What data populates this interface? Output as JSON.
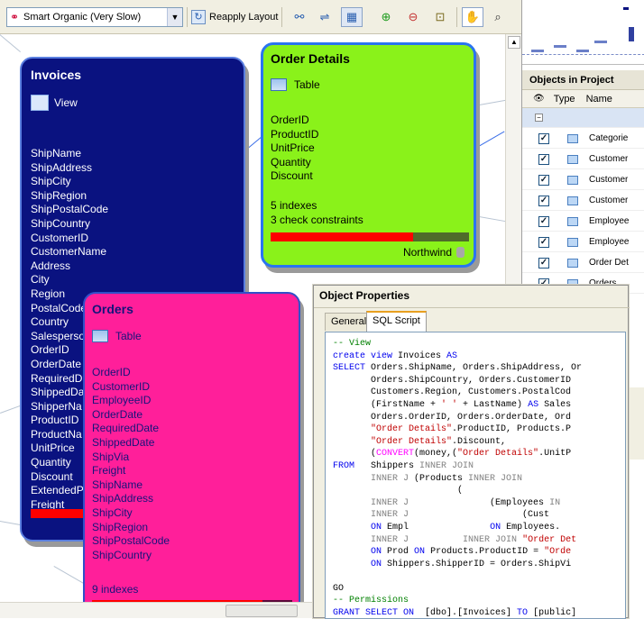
{
  "toolbar": {
    "layout_combo": "Smart Organic (Very Slow)",
    "reapply_label": "Reapply Layout"
  },
  "invoices": {
    "title": "Invoices",
    "type_label": "View",
    "fields": [
      "ShipName",
      "ShipAddress",
      "ShipCity",
      "ShipRegion",
      "ShipPostalCode",
      "ShipCountry",
      "CustomerID",
      "CustomerName",
      "Address",
      "City",
      "Region",
      "PostalCode",
      "Country",
      "Salesperson",
      "OrderID",
      "OrderDate",
      "RequiredD",
      "ShippedDa",
      "ShipperNa",
      "ProductID",
      "ProductNa",
      "UnitPrice",
      "Quantity",
      "Discount",
      "ExtendedP",
      "Freight"
    ]
  },
  "order_details": {
    "title": "Order Details",
    "type_label": "Table",
    "fields": [
      "OrderID",
      "ProductID",
      "UnitPrice",
      "Quantity",
      "Discount"
    ],
    "indexes": "5 indexes",
    "constraints": "3 check constraints",
    "database": "Northwind"
  },
  "orders": {
    "title": "Orders",
    "type_label": "Table",
    "fields": [
      "OrderID",
      "CustomerID",
      "EmployeeID",
      "OrderDate",
      "RequiredDate",
      "ShippedDate",
      "ShipVia",
      "Freight",
      "ShipName",
      "ShipAddress",
      "ShipCity",
      "ShipRegion",
      "ShipPostalCode",
      "ShipCountry"
    ],
    "indexes": "9 indexes"
  },
  "objects_panel": {
    "title": "Objects in Project",
    "col_type": "Type",
    "col_name": "Name",
    "rows": [
      "Categorie",
      "Customer",
      "Customer",
      "Customer",
      "Employee",
      "Employee",
      "Order Det",
      "Orders"
    ]
  },
  "object_properties": {
    "title": "Object Properties",
    "tab_general": "General",
    "tab_sql": "SQL Script"
  },
  "colors": {
    "invoices_bg": "#0a1280",
    "order_details_bg": "#8af21a",
    "orders_bg": "#ff1f9a",
    "bar_red": "#ff0000"
  },
  "icons": [
    "layout-icon",
    "reapply-icon",
    "zoom-in-icon",
    "zoom-out-icon",
    "fit-icon",
    "hand-icon",
    "zoom-tool-icon",
    "view-icon",
    "table-icon",
    "database-icon"
  ]
}
